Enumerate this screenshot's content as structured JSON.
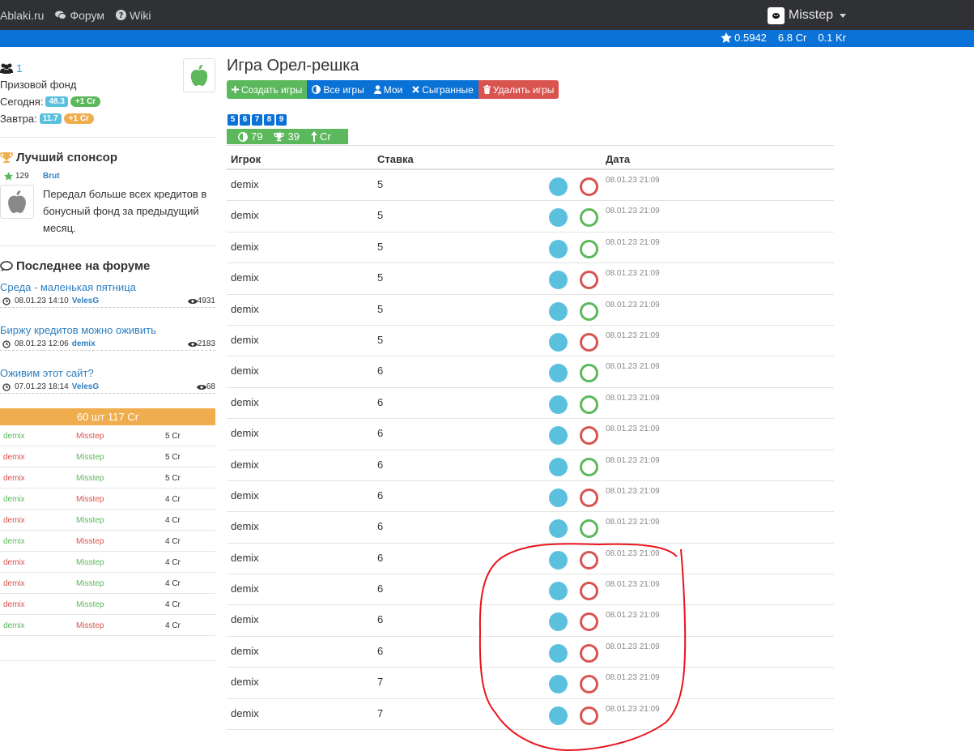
{
  "nav": {
    "brand": "Ablaki.ru",
    "forum": "Форум",
    "wiki": "Wiki",
    "user": "Misstep"
  },
  "stats": {
    "rating": "0.5942",
    "credits": "6.8 Cr",
    "kg": "0.1 Kr"
  },
  "sidebar": {
    "players_count": "1",
    "prize_fund_label": "Призовой фонд",
    "today_label": "Сегодня:",
    "today_value": "48.3",
    "today_bonus": "+1 Cr",
    "tomorrow_label": "Завтра:",
    "tomorrow_value": "11.7",
    "tomorrow_bonus": "+1 Cr",
    "sponsor_title": "Лучший спонсор",
    "sponsor_score": "129",
    "sponsor_name": "Brut",
    "sponsor_text": "Передал больше всех кредитов в бонусный фонд за предыдущий месяц.",
    "forum_title": "Последнее на форуме",
    "forum_items": [
      {
        "topic": "Среда - маленькая пятница",
        "date": "08.01.23 14:10",
        "author": "VelesG",
        "views": "4931"
      },
      {
        "topic": "Биржу кредитов можно оживить",
        "date": "08.01.23 12:06",
        "author": "demix",
        "views": "2183"
      },
      {
        "topic": "Оживим этот сайт?",
        "date": "07.01.23 18:14",
        "author": "VelesG",
        "views": "68"
      }
    ],
    "mini_header": "60 шт 117 Cr",
    "mini_rows": [
      {
        "p1": "demix",
        "p1_win": true,
        "p2": "Misstep",
        "p2_win": false,
        "amount": "5 Cr"
      },
      {
        "p1": "demix",
        "p1_win": false,
        "p2": "Misstep",
        "p2_win": true,
        "amount": "5 Cr"
      },
      {
        "p1": "demix",
        "p1_win": false,
        "p2": "Misstep",
        "p2_win": true,
        "amount": "5 Cr"
      },
      {
        "p1": "demix",
        "p1_win": true,
        "p2": "Misstep",
        "p2_win": false,
        "amount": "4 Cr"
      },
      {
        "p1": "demix",
        "p1_win": false,
        "p2": "Misstep",
        "p2_win": true,
        "amount": "4 Cr"
      },
      {
        "p1": "demix",
        "p1_win": true,
        "p2": "Misstep",
        "p2_win": false,
        "amount": "4 Cr"
      },
      {
        "p1": "demix",
        "p1_win": false,
        "p2": "Misstep",
        "p2_win": true,
        "amount": "4 Cr"
      },
      {
        "p1": "demix",
        "p1_win": false,
        "p2": "Misstep",
        "p2_win": true,
        "amount": "4 Cr"
      },
      {
        "p1": "demix",
        "p1_win": false,
        "p2": "Misstep",
        "p2_win": true,
        "amount": "4 Cr"
      },
      {
        "p1": "demix",
        "p1_win": true,
        "p2": "Misstep",
        "p2_win": false,
        "amount": "4 Cr"
      }
    ]
  },
  "main": {
    "title": "Игра Орел-решка",
    "buttons": {
      "create": "Создать игры",
      "all": "Все игры",
      "mine": "Мои",
      "played": "Сыгранные",
      "delete": "Удалить игры"
    },
    "pages": [
      "5",
      "6",
      "7",
      "8",
      "9"
    ],
    "counts": {
      "games": "79",
      "wins": "39",
      "currency": "Cr"
    },
    "columns": {
      "player": "Игрок",
      "bet": "Ставка",
      "date": "Дата"
    },
    "rows": [
      {
        "player": "demix",
        "bet": "5",
        "result": "lose",
        "date": "08.01.23 21:09"
      },
      {
        "player": "demix",
        "bet": "5",
        "result": "win",
        "date": "08.01.23 21:09"
      },
      {
        "player": "demix",
        "bet": "5",
        "result": "win",
        "date": "08.01.23 21:09"
      },
      {
        "player": "demix",
        "bet": "5",
        "result": "lose",
        "date": "08.01.23 21:09"
      },
      {
        "player": "demix",
        "bet": "5",
        "result": "win",
        "date": "08.01.23 21:09"
      },
      {
        "player": "demix",
        "bet": "5",
        "result": "lose",
        "date": "08.01.23 21:09"
      },
      {
        "player": "demix",
        "bet": "6",
        "result": "win",
        "date": "08.01.23 21:09"
      },
      {
        "player": "demix",
        "bet": "6",
        "result": "win",
        "date": "08.01.23 21:09"
      },
      {
        "player": "demix",
        "bet": "6",
        "result": "lose",
        "date": "08.01.23 21:09"
      },
      {
        "player": "demix",
        "bet": "6",
        "result": "win",
        "date": "08.01.23 21:09"
      },
      {
        "player": "demix",
        "bet": "6",
        "result": "lose",
        "date": "08.01.23 21:09"
      },
      {
        "player": "demix",
        "bet": "6",
        "result": "win",
        "date": "08.01.23 21:09"
      },
      {
        "player": "demix",
        "bet": "6",
        "result": "lose",
        "date": "08.01.23 21:09"
      },
      {
        "player": "demix",
        "bet": "6",
        "result": "lose",
        "date": "08.01.23 21:09"
      },
      {
        "player": "demix",
        "bet": "6",
        "result": "lose",
        "date": "08.01.23 21:09"
      },
      {
        "player": "demix",
        "bet": "6",
        "result": "lose",
        "date": "08.01.23 21:09"
      },
      {
        "player": "demix",
        "bet": "7",
        "result": "lose",
        "date": "08.01.23 21:09"
      },
      {
        "player": "demix",
        "bet": "7",
        "result": "lose",
        "date": "08.01.23 21:09"
      }
    ]
  },
  "colors": {
    "navbar": "#2f3134",
    "accent_blue": "#0a72d6",
    "success": "#5cb85c",
    "danger": "#d9534f",
    "warning": "#f0ad4e",
    "info": "#5bc0de",
    "annotation": "#e8141c"
  }
}
